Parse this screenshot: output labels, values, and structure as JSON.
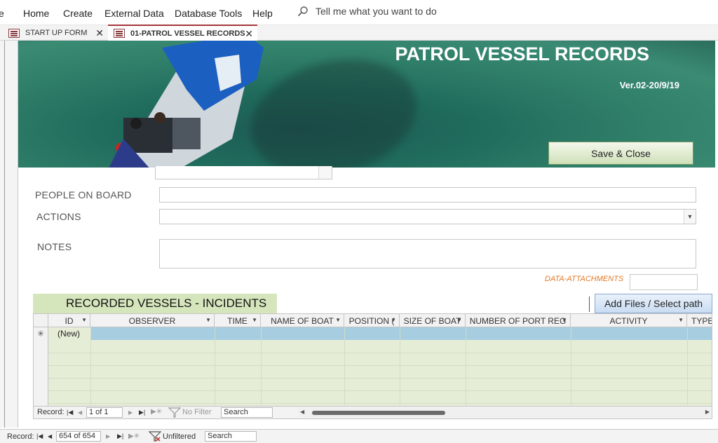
{
  "ribbon": {
    "menu": [
      "e",
      "Home",
      "Create",
      "External Data",
      "Database Tools",
      "Help"
    ],
    "tell_me": "Tell me what you want to do"
  },
  "tabs": [
    {
      "label": "START UP FORM",
      "active": false
    },
    {
      "label": "01-PATROL VESSEL RECORDS",
      "active": true
    }
  ],
  "header": {
    "title": "PATROL VESSEL RECORDS",
    "version": "Ver.02-20/9/19",
    "save_label": "Save & Close"
  },
  "form": {
    "people_label": "PEOPLE ON BOARD",
    "actions_label": "ACTIONS",
    "notes_label": "NOTES",
    "attachments_label": "DATA-ATTACHMENTS"
  },
  "subform": {
    "title": "RECORDED VESSELS - INCIDENTS",
    "add_files_label": "Add Files / Select path",
    "columns": [
      "ID",
      "OBSERVER",
      "TIME",
      "NAME OF BOAT",
      "POSITION (",
      "SIZE OF BOAT",
      "NUMBER OF PORT REG",
      "ACTIVITY",
      "TYPE"
    ],
    "new_row_label": "(New)",
    "new_row_marker": "✳",
    "nav": {
      "record_label": "Record:",
      "position": "1 of 1",
      "filter": "No Filter",
      "search": "Search"
    }
  },
  "status": {
    "record_label": "Record:",
    "position": "654 of 654",
    "filter": "Unfiltered",
    "search": "Search"
  },
  "colors": {
    "accent_tab": "#a4373a",
    "subform_title_bg": "#d6e6bc",
    "new_row_highlight": "#a6cde0",
    "attachments_label": "#e07b2a"
  }
}
